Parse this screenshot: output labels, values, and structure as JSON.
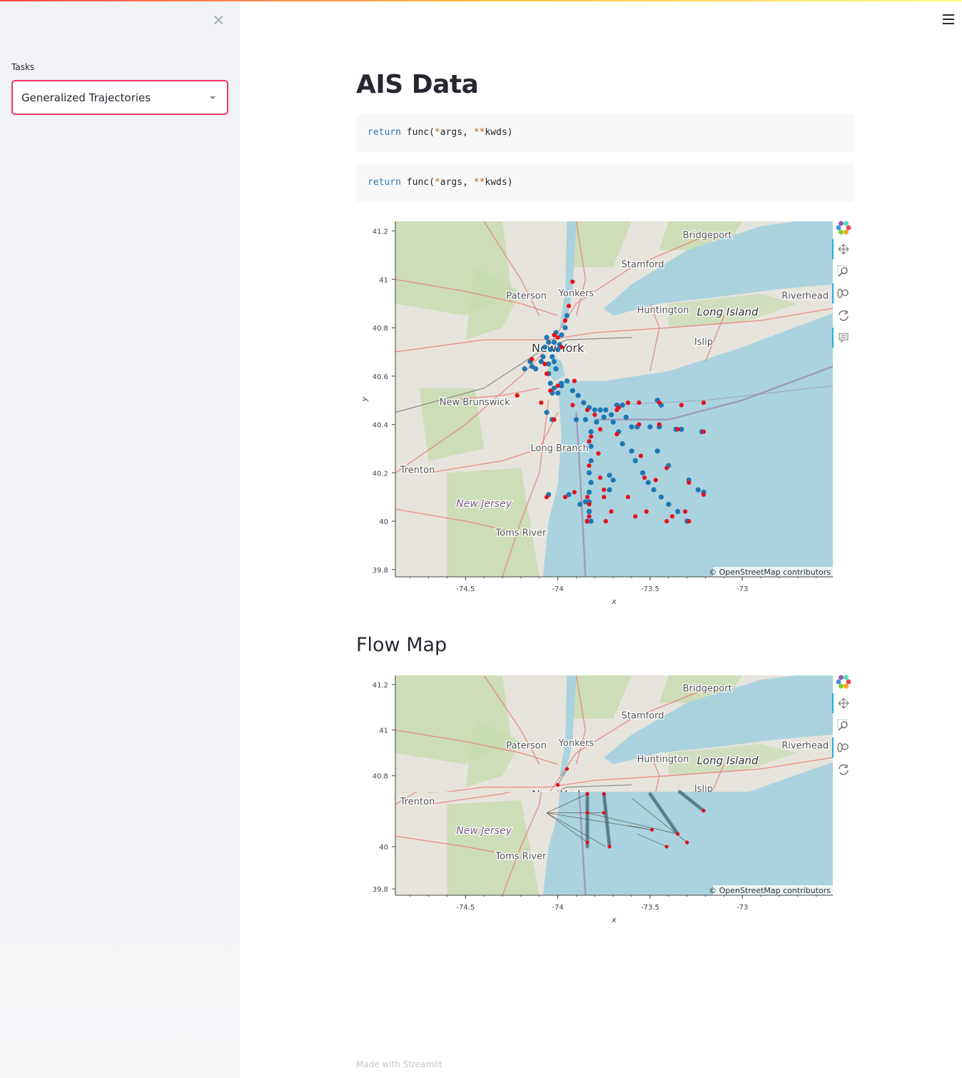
{
  "sidebar": {
    "close_glyph": "×",
    "tasks_label": "Tasks",
    "select_value": "Generalized Trajectories"
  },
  "main": {
    "title": "AIS Data",
    "code_blocks": [
      {
        "keyword": "return",
        "text_before": " func(",
        "op1": "*",
        "mid": "args, ",
        "op2": "**",
        "end": "kwds)"
      },
      {
        "keyword": "return",
        "text_before": " func(",
        "op1": "*",
        "mid": "args, ",
        "op2": "**",
        "end": "kwds)"
      }
    ],
    "flow_map_heading": "Flow Map",
    "footer": "Made with Streamlit"
  },
  "map_labels": {
    "bridgeport": "Bridgeport",
    "stamford": "Stamford",
    "paterson": "Paterson",
    "yonkers": "Yonkers",
    "riverhead": "Riverhead",
    "huntington": "Huntington",
    "long_island": "Long Island",
    "new_york": "New York",
    "islip": "Islip",
    "new_brunswick": "New Brunswick",
    "long_branch": "Long Branch",
    "trenton": "Trenton",
    "new_jersey": "New Jersey",
    "toms_river": "Toms River",
    "attribution": "© OpenStreetMap contributors"
  },
  "chart_data": [
    {
      "type": "scatter",
      "xlabel": "x",
      "ylabel": "y",
      "xticks": [
        "-74.5",
        "-74",
        "-73.5",
        "-73"
      ],
      "yticks": [
        "41.2",
        "41",
        "40.8",
        "40.6",
        "40.4",
        "40.2",
        "40",
        "39.8"
      ],
      "xlim": [
        -74.88,
        -72.51
      ],
      "ylim": [
        39.77,
        41.24
      ],
      "series": [
        {
          "color": "#1f77b4",
          "points": [
            [
              -74.18,
              40.63
            ],
            [
              -74.15,
              40.66
            ],
            [
              -74.14,
              40.64
            ],
            [
              -74.12,
              40.63
            ],
            [
              -74.09,
              40.66
            ],
            [
              -74.08,
              40.68
            ],
            [
              -74.07,
              40.72
            ],
            [
              -74.06,
              40.76
            ],
            [
              -74.05,
              40.74
            ],
            [
              -74.04,
              40.71
            ],
            [
              -74.03,
              40.68
            ],
            [
              -74.02,
              40.74
            ],
            [
              -74.01,
              40.78
            ],
            [
              -74.0,
              40.71
            ],
            [
              -73.99,
              40.73
            ],
            [
              -74.05,
              40.65
            ],
            [
              -74.05,
              40.61
            ],
            [
              -74.04,
              40.57
            ],
            [
              -74.03,
              40.53
            ],
            [
              -74.02,
              40.55
            ],
            [
              -74.0,
              40.53
            ],
            [
              -73.98,
              40.56
            ],
            [
              -73.95,
              40.58
            ],
            [
              -73.92,
              40.54
            ],
            [
              -73.89,
              40.52
            ],
            [
              -73.86,
              40.49
            ],
            [
              -73.83,
              40.47
            ],
            [
              -73.8,
              40.46
            ],
            [
              -73.77,
              40.46
            ],
            [
              -73.74,
              40.46
            ],
            [
              -73.71,
              40.44
            ],
            [
              -73.68,
              40.48
            ],
            [
              -73.65,
              40.48
            ],
            [
              -73.63,
              40.43
            ],
            [
              -73.6,
              40.39
            ],
            [
              -73.57,
              40.39
            ],
            [
              -73.5,
              40.39
            ],
            [
              -73.45,
              40.39
            ],
            [
              -73.36,
              40.38
            ],
            [
              -73.33,
              40.38
            ],
            [
              -73.22,
              40.37
            ],
            [
              -73.46,
              40.5
            ],
            [
              -73.44,
              40.48
            ],
            [
              -73.82,
              40.37
            ],
            [
              -73.82,
              40.31
            ],
            [
              -73.82,
              40.25
            ],
            [
              -73.83,
              40.2
            ],
            [
              -73.82,
              40.16
            ],
            [
              -73.83,
              40.12
            ],
            [
              -73.83,
              40.08
            ],
            [
              -73.83,
              40.04
            ],
            [
              -73.84,
              40.0
            ],
            [
              -73.82,
              40.0
            ],
            [
              -73.83,
              40.04
            ],
            [
              -73.85,
              40.08
            ],
            [
              -73.88,
              40.07
            ],
            [
              -73.94,
              40.11
            ],
            [
              -74.05,
              40.11
            ],
            [
              -74.06,
              40.45
            ],
            [
              -74.03,
              40.42
            ],
            [
              -73.9,
              40.42
            ],
            [
              -73.85,
              40.42
            ],
            [
              -73.79,
              40.41
            ],
            [
              -73.75,
              40.43
            ],
            [
              -73.7,
              40.41
            ],
            [
              -73.67,
              40.37
            ],
            [
              -73.65,
              40.32
            ],
            [
              -73.6,
              40.29
            ],
            [
              -73.58,
              40.25
            ],
            [
              -73.54,
              40.2
            ],
            [
              -73.51,
              40.16
            ],
            [
              -73.48,
              40.13
            ],
            [
              -73.44,
              40.1
            ],
            [
              -73.4,
              40.07
            ],
            [
              -73.35,
              40.04
            ],
            [
              -73.3,
              40.0
            ],
            [
              -73.29,
              40.17
            ],
            [
              -73.21,
              40.12
            ],
            [
              -73.24,
              40.13
            ],
            [
              -73.4,
              40.23
            ],
            [
              -73.46,
              40.29
            ],
            [
              -73.96,
              40.8
            ],
            [
              -73.95,
              40.85
            ],
            [
              -73.98,
              40.77
            ],
            [
              -74.02,
              40.66
            ],
            [
              -74.01,
              40.63
            ],
            [
              -73.98,
              40.57
            ],
            [
              -74.03,
              40.42
            ],
            [
              -73.72,
              40.19
            ],
            [
              -73.7,
              40.17
            ],
            [
              -73.72,
              40.13
            ]
          ]
        },
        {
          "color": "#e4101c",
          "points": [
            [
              -73.92,
              40.99
            ],
            [
              -73.94,
              40.89
            ],
            [
              -73.96,
              40.83
            ],
            [
              -74.0,
              40.76
            ],
            [
              -74.02,
              40.77
            ],
            [
              -73.98,
              40.72
            ],
            [
              -74.14,
              40.67
            ],
            [
              -74.07,
              40.65
            ],
            [
              -74.06,
              40.61
            ],
            [
              -74.04,
              40.54
            ],
            [
              -74.0,
              40.56
            ],
            [
              -73.91,
              40.58
            ],
            [
              -74.22,
              40.52
            ],
            [
              -74.09,
              40.49
            ],
            [
              -74.02,
              40.42
            ],
            [
              -73.92,
              40.48
            ],
            [
              -73.84,
              40.46
            ],
            [
              -73.8,
              40.44
            ],
            [
              -73.77,
              40.38
            ],
            [
              -73.82,
              40.35
            ],
            [
              -73.83,
              40.33
            ],
            [
              -73.78,
              40.28
            ],
            [
              -73.67,
              40.47
            ],
            [
              -73.62,
              40.49
            ],
            [
              -73.56,
              40.49
            ],
            [
              -73.68,
              40.36
            ],
            [
              -73.68,
              40.46
            ],
            [
              -73.45,
              40.49
            ],
            [
              -73.33,
              40.48
            ],
            [
              -73.21,
              40.49
            ],
            [
              -73.56,
              40.4
            ],
            [
              -73.45,
              40.4
            ],
            [
              -73.35,
              40.38
            ],
            [
              -73.21,
              40.37
            ],
            [
              -73.55,
              40.27
            ],
            [
              -73.41,
              40.22
            ],
            [
              -73.47,
              40.17
            ],
            [
              -73.53,
              40.18
            ],
            [
              -73.29,
              40.16
            ],
            [
              -73.21,
              40.11
            ],
            [
              -73.77,
              40.18
            ],
            [
              -73.83,
              40.23
            ],
            [
              -73.84,
              40.1
            ],
            [
              -73.83,
              40.02
            ],
            [
              -73.84,
              40.0
            ],
            [
              -73.74,
              40.0
            ],
            [
              -73.91,
              40.12
            ],
            [
              -73.96,
              40.1
            ],
            [
              -74.06,
              40.1
            ],
            [
              -73.75,
              40.1
            ],
            [
              -73.62,
              40.1
            ],
            [
              -73.71,
              40.04
            ],
            [
              -73.58,
              40.02
            ],
            [
              -73.52,
              40.04
            ],
            [
              -73.41,
              40.0
            ],
            [
              -73.38,
              40.02
            ],
            [
              -73.31,
              40.04
            ],
            [
              -73.29,
              40.0
            ],
            [
              -73.75,
              40.13
            ],
            [
              -73.83,
              40.07
            ]
          ]
        }
      ]
    },
    {
      "type": "line",
      "xlabel": "x",
      "ylabel": "",
      "xticks": [
        "-74.5",
        "-74",
        "-73.5",
        "-73"
      ],
      "yticks": [
        "41.2",
        "41",
        "40.8",
        "40",
        "39.8"
      ],
      "xlim": [
        -74.88,
        -72.51
      ],
      "y_view_breaks": {
        "top": [
          40.73,
          41.24
        ],
        "bottom": [
          39.77,
          40.26
        ]
      },
      "segments": [
        [
          [
            -74.0,
            40.76
          ],
          [
            -73.95,
            40.83
          ]
        ],
        [
          [
            -74.06,
            40.16
          ],
          [
            -73.84,
            40.25
          ]
        ],
        [
          [
            -74.06,
            40.16
          ],
          [
            -73.84,
            40.02
          ]
        ],
        [
          [
            -74.06,
            40.16
          ],
          [
            -73.74,
            40.0
          ]
        ],
        [
          [
            -74.06,
            40.16
          ],
          [
            -73.75,
            40.16
          ]
        ],
        [
          [
            -74.06,
            40.16
          ],
          [
            -73.49,
            40.08
          ]
        ],
        [
          [
            -73.84,
            40.25
          ],
          [
            -73.84,
            40.0
          ]
        ],
        [
          [
            -73.75,
            40.25
          ],
          [
            -73.72,
            40.0
          ]
        ],
        [
          [
            -73.5,
            40.25
          ],
          [
            -73.35,
            40.06
          ]
        ],
        [
          [
            -73.34,
            40.26
          ],
          [
            -73.21,
            40.17
          ]
        ],
        [
          [
            -73.84,
            40.16
          ],
          [
            -73.35,
            40.06
          ]
        ],
        [
          [
            -73.62,
            40.1
          ],
          [
            -73.49,
            40.08
          ]
        ],
        [
          [
            -73.6,
            40.23
          ],
          [
            -73.3,
            40.02
          ]
        ],
        [
          [
            -73.57,
            40.06
          ],
          [
            -73.41,
            40.0
          ]
        ]
      ],
      "nodes": [
        [
          -74.0,
          40.76
        ],
        [
          -73.95,
          40.83
        ],
        [
          -73.84,
          40.25
        ],
        [
          -73.84,
          40.16
        ],
        [
          -73.84,
          40.02
        ],
        [
          -73.75,
          40.25
        ],
        [
          -73.75,
          40.16
        ],
        [
          -73.72,
          40.0
        ],
        [
          -73.49,
          40.08
        ],
        [
          -73.35,
          40.06
        ],
        [
          -73.21,
          40.17
        ],
        [
          -73.3,
          40.02
        ],
        [
          -73.41,
          40.0
        ]
      ]
    }
  ],
  "colors": {
    "accent": "#f63366",
    "water": "#aad3df",
    "land": "#e6e4dc",
    "park": "#c8dcb0",
    "road": "#e8807a",
    "blue_points": "#1f77b4",
    "red_points": "#e4101c"
  },
  "toolbar_icons": [
    "bokeh-logo-icon",
    "pan-icon",
    "box-zoom-icon",
    "wheel-zoom-icon",
    "reset-icon",
    "hover-icon"
  ]
}
